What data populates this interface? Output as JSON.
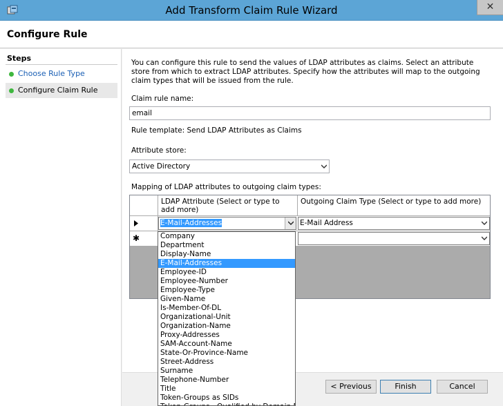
{
  "window": {
    "title": "Add Transform Claim Rule Wizard",
    "close_glyph": "✕"
  },
  "header": {
    "title": "Configure Rule"
  },
  "steps": {
    "title": "Steps",
    "items": [
      {
        "label": "Choose Rule Type",
        "state": "link"
      },
      {
        "label": "Configure Claim Rule",
        "state": "current"
      }
    ]
  },
  "main": {
    "intro": "You can configure this rule to send the values of LDAP attributes as claims. Select an attribute store from which to extract LDAP attributes. Specify how the attributes will map to the outgoing claim types that will be issued from the rule.",
    "claim_rule_name_label": "Claim rule name:",
    "claim_rule_name_value": "email",
    "rule_template": "Rule template: Send LDAP Attributes as Claims",
    "attribute_store_label": "Attribute store:",
    "attribute_store_value": "Active Directory",
    "mapping_label": "Mapping of LDAP attributes to outgoing claim types:"
  },
  "grid": {
    "columns": [
      "LDAP Attribute (Select or type to add more)",
      "Outgoing Claim Type (Select or type to add more)"
    ],
    "rows": [
      {
        "marker": "▶",
        "ldap": "E-Mail-Addresses",
        "claim": "E-Mail Address"
      },
      {
        "marker": "✱",
        "ldap": "",
        "claim": ""
      }
    ]
  },
  "dropdown": {
    "selected": "E-Mail-Addresses",
    "options": [
      "Company",
      "Department",
      "Display-Name",
      "E-Mail-Addresses",
      "Employee-ID",
      "Employee-Number",
      "Employee-Type",
      "Given-Name",
      "Is-Member-Of-DL",
      "Organizational-Unit",
      "Organization-Name",
      "Proxy-Addresses",
      "SAM-Account-Name",
      "State-Or-Province-Name",
      "Street-Address",
      "Surname",
      "Telephone-Number",
      "Title",
      "Token-Groups as SIDs",
      "Token-Groups - Qualified by Domain Name"
    ]
  },
  "buttons": {
    "previous": "< Previous",
    "finish": "Finish",
    "cancel": "Cancel"
  },
  "colors": {
    "titlebar": "#5ca5d6",
    "selection": "#3399ff",
    "step_dot": "#3fb73f",
    "link": "#1a5fb4"
  }
}
